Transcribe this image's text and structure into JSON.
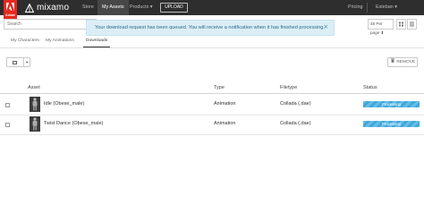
{
  "nav": {
    "adobe_label": "Adobe",
    "brand": "mixamo",
    "items": [
      {
        "label": "Store"
      },
      {
        "label": "My Assets"
      },
      {
        "label": "Products ▾"
      }
    ],
    "upload_label": "UPLOAD",
    "pricing_label": "Pricing",
    "user_label": "Esteban ▾"
  },
  "search": {
    "placeholder": "Search"
  },
  "pagination": {
    "per_page": "48 Per page ⬍"
  },
  "notification": {
    "message": "Your download request has been queued. You will receive a notification when it has finished processing.",
    "close": "✕"
  },
  "tabs": [
    {
      "label": "My Characters"
    },
    {
      "label": "My Animations"
    },
    {
      "label": "Downloads"
    }
  ],
  "toolbar": {
    "select_caret": "▾",
    "remove_label": "REMOVE"
  },
  "table": {
    "headers": [
      "Asset",
      "Type",
      "Filetype",
      "Status"
    ],
    "rows": [
      {
        "asset": "Idle (Obese_male)",
        "type": "Animation",
        "filetype": "Collada (.dae)",
        "status": "Processing"
      },
      {
        "asset": "Twist Dance (Obese_male)",
        "type": "Animation",
        "filetype": "Collada (.dae)",
        "status": "Processing"
      }
    ]
  },
  "colors": {
    "adobe_red": "#e8281e",
    "nav_bg": "#2e2e2e",
    "notice_bg": "#dbeef6",
    "status_blue": "#3ca8dd"
  }
}
